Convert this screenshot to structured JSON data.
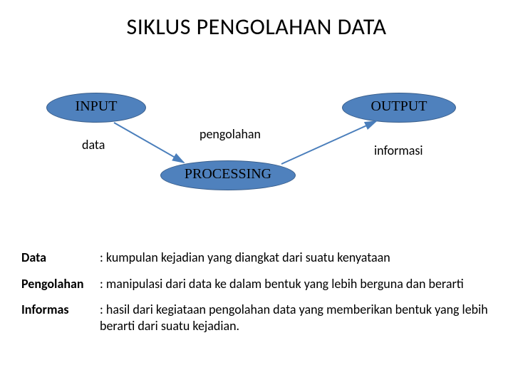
{
  "title": "SIKLUS PENGOLAHAN DATA",
  "nodes": {
    "input": "INPUT",
    "processing": "PROCESSING",
    "output": "OUTPUT"
  },
  "sublabels": {
    "input": "data",
    "processing": "pengolahan",
    "output": "informasi"
  },
  "definitions": [
    {
      "term": "Data",
      "body": ": kumpulan kejadian yang diangkat dari suatu kenyataan"
    },
    {
      "term": "Pengolahan",
      "body": ": manipulasi dari data ke dalam bentuk yang lebih berguna dan berarti"
    },
    {
      "term": "Informas",
      "body": ": hasil dari kegiataan pengolahan data yang memberikan bentuk yang lebih berarti dari suatu kejadian."
    }
  ]
}
